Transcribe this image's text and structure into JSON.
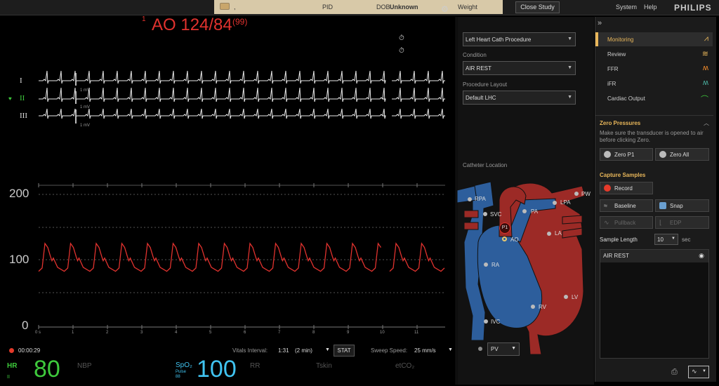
{
  "topbar": {
    "patient_name": ",",
    "pid_label": "PID",
    "dob_label": "DOB",
    "dob_value": "Unknown",
    "weight_label": "Weight",
    "close_study": "Close Study",
    "system": "System",
    "help": "Help",
    "brand": "PHILIPS"
  },
  "pressure": {
    "channel_num": "1",
    "label": "AO 124/84",
    "mean": "(99)"
  },
  "ecg": {
    "leads": [
      "I",
      "II",
      "III"
    ],
    "mv_label": "1 mV"
  },
  "scale": {
    "top": "200",
    "mid": "100",
    "bottom": "0"
  },
  "time_ticks": [
    "0 s",
    "1",
    "2",
    "3",
    "4",
    "5",
    "6",
    "7",
    "8",
    "9",
    "10",
    "11"
  ],
  "status_bar": {
    "elapsed": "00:00:29",
    "vitals_interval_label": "Vitals Interval:",
    "vitals_interval_value": "1:31",
    "vitals_interval_period": "(2 min)",
    "stat": "STAT",
    "sweep_label": "Sweep Speed:",
    "sweep_value": "25 mm/s"
  },
  "vitals": {
    "hr_label": "HR",
    "hr_sub": "II",
    "hr_value": "80",
    "nbp_label": "NBP",
    "spo2_label": "SpO₂",
    "spo2_sub1": "Pulse",
    "spo2_sub2": "88",
    "spo2_value": "100",
    "rr_label": "RR",
    "tskin_label": "Tskin",
    "etco2_label": "etCO₂"
  },
  "procedure": {
    "procedure_value": "Left Heart Cath Procedure",
    "condition_label": "Condition",
    "condition_value": "AIR REST",
    "layout_label": "Procedure Layout",
    "layout_value": "Default LHC",
    "catheter_label": "Catheter Location",
    "heart_labels": {
      "rpa": "RPA",
      "svc": "SVC",
      "pa": "PA",
      "lpa": "LPA",
      "pw": "PW",
      "p1": "P1",
      "ao": "AO",
      "la": "LA",
      "ra": "RA",
      "rv": "RV",
      "lv": "LV",
      "ivc": "IVC"
    },
    "pv_value": "PV"
  },
  "sidebar": {
    "expand": "»",
    "nav": [
      "Monitoring",
      "Review",
      "FFR",
      "iFR",
      "Cardiac Output"
    ],
    "zero_title": "Zero Pressures",
    "zero_help": "Make sure the transducer is opened to air before clicking Zero.",
    "zero_p1": "Zero P1",
    "zero_all": "Zero All",
    "capture_title": "Capture Samples",
    "record": "Record",
    "baseline": "Baseline",
    "snap": "Snap",
    "pullback": "Pullback",
    "edp": "EDP",
    "sample_length_label": "Sample Length",
    "sample_length_value": "10",
    "sample_length_unit": "sec",
    "sample_list_head": "AIR REST"
  },
  "colors": {
    "pressure": "#e0322e",
    "hr": "#3ec93c",
    "spo2": "#40c3f0",
    "accent": "#e9b75a"
  }
}
